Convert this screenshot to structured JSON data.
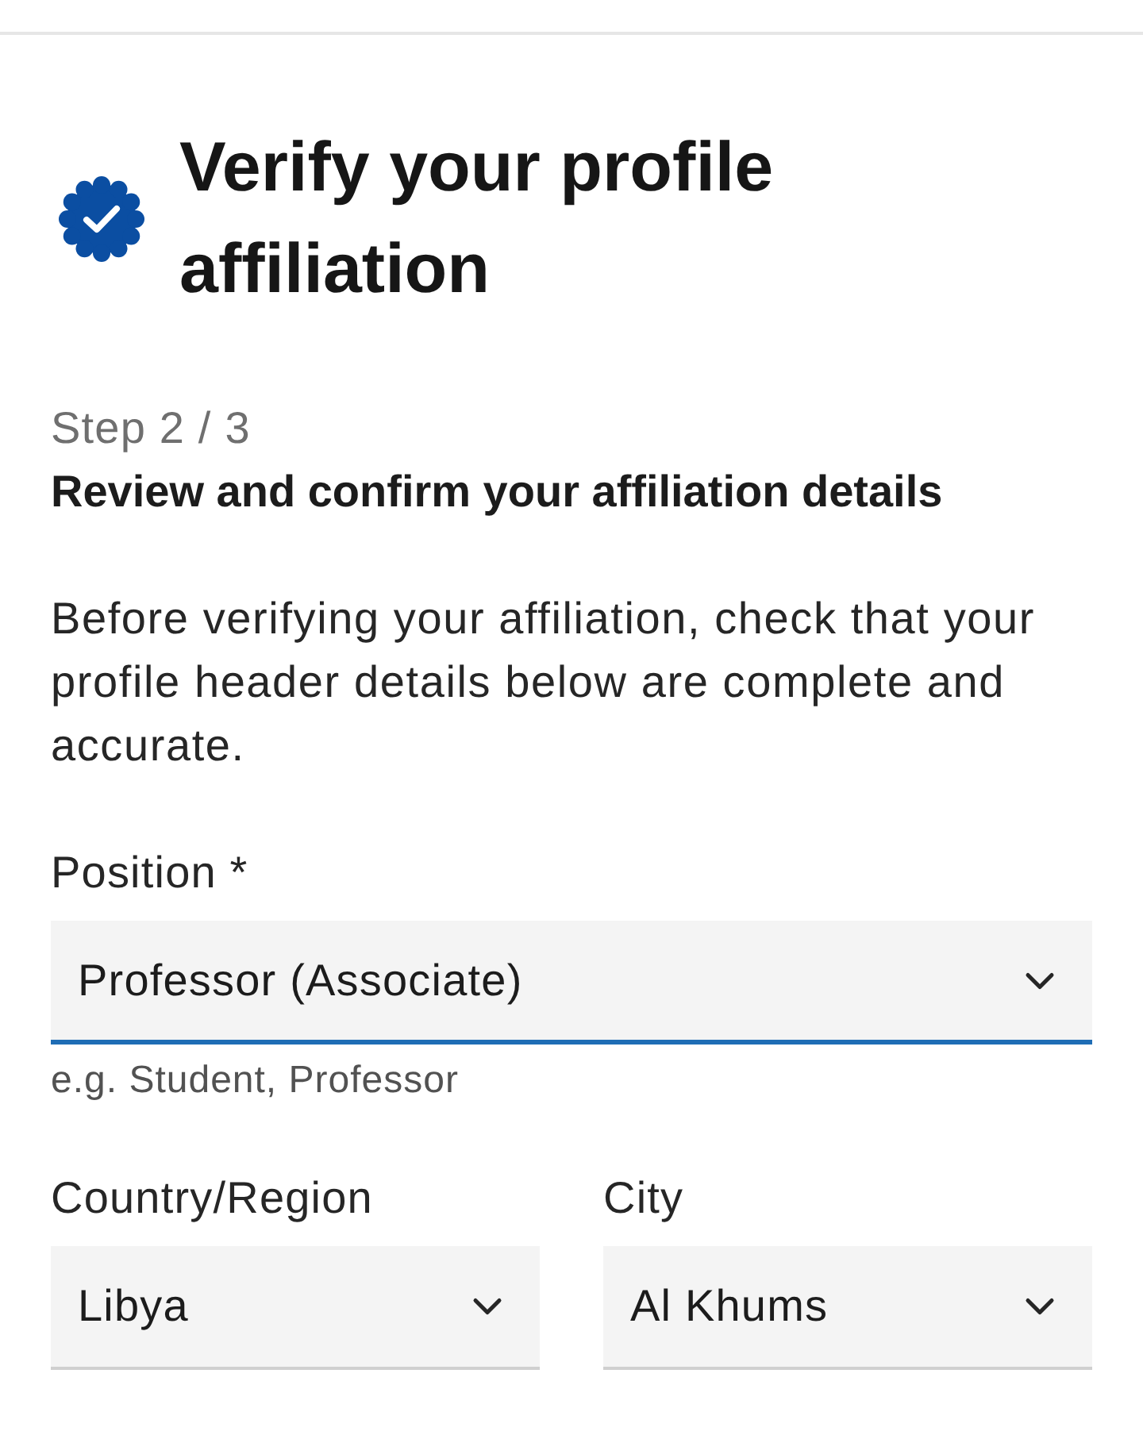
{
  "header": {
    "title": "Verify your profile affiliation"
  },
  "step": {
    "counter": "Step 2 / 3",
    "heading": "Review and confirm your affiliation details"
  },
  "intro": "Before verifying your affiliation, check that your profile header details below are complete and accurate.",
  "position": {
    "label": "Position *",
    "value": "Professor (Associate)",
    "helper": "e.g. Student, Professor",
    "focused": true
  },
  "location": [
    {
      "label": "Country/Region",
      "value": "Libya",
      "focused": false
    },
    {
      "label": "City",
      "value": "Al Khums",
      "focused": false
    }
  ]
}
